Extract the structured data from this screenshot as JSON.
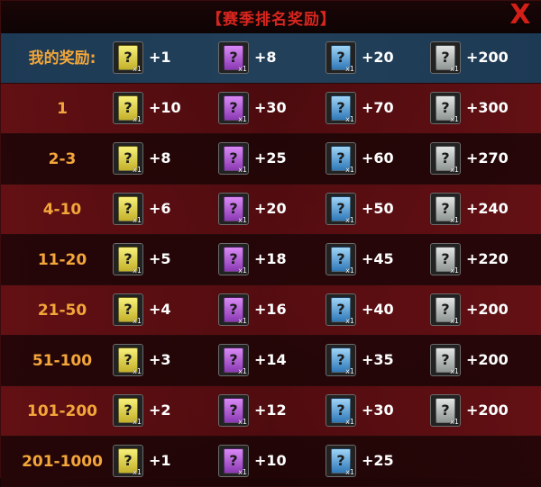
{
  "header": {
    "title": "【赛季排名奖励】",
    "close_label": "X"
  },
  "rows": [
    {
      "rank": "我的奖励:",
      "gold": "+1",
      "purple": "+8",
      "blue": "+20",
      "gray": "+200"
    },
    {
      "rank": "1",
      "gold": "+10",
      "purple": "+30",
      "blue": "+70",
      "gray": "+300"
    },
    {
      "rank": "2-3",
      "gold": "+8",
      "purple": "+25",
      "blue": "+60",
      "gray": "+270"
    },
    {
      "rank": "4-10",
      "gold": "+6",
      "purple": "+20",
      "blue": "+50",
      "gray": "+240"
    },
    {
      "rank": "11-20",
      "gold": "+5",
      "purple": "+18",
      "blue": "+45",
      "gray": "+220"
    },
    {
      "rank": "21-50",
      "gold": "+4",
      "purple": "+16",
      "blue": "+40",
      "gray": "+200"
    },
    {
      "rank": "51-100",
      "gold": "+3",
      "purple": "+14",
      "blue": "+35",
      "gray": "+200"
    },
    {
      "rank": "101-200",
      "gold": "+2",
      "purple": "+12",
      "blue": "+30",
      "gray": "+200"
    },
    {
      "rank": "201-1000",
      "gold": "+1",
      "purple": "+10",
      "blue": "+25",
      "gray": ""
    }
  ],
  "card": {
    "glyph": "?",
    "qty": "x1"
  },
  "colors": {
    "title": "#d8261f",
    "rank_text": "#f3a63a",
    "gold_card": "#e6d84a",
    "purple_card": "#b45fdc",
    "blue_card": "#5aa6e0",
    "gray_card": "#b8bdbb"
  },
  "icons": {
    "gold": "gold-card-icon",
    "purple": "purple-card-icon",
    "blue": "blue-card-icon",
    "gray": "gray-card-icon",
    "close": "close-icon"
  }
}
